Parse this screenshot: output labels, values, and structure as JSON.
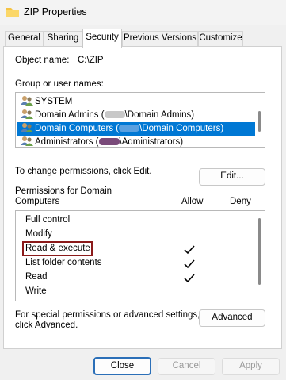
{
  "window": {
    "title": "ZIP Properties",
    "icon": "folder-icon"
  },
  "tabs": [
    {
      "label": "General",
      "active": false
    },
    {
      "label": "Sharing",
      "active": false
    },
    {
      "label": "Security",
      "active": true
    },
    {
      "label": "Previous Versions",
      "active": false
    },
    {
      "label": "Customize",
      "active": false
    }
  ],
  "object": {
    "label": "Object name:",
    "value": "C:\\ZIP"
  },
  "groups": {
    "label": "Group or user names:",
    "items": [
      {
        "prefix": "SYSTEM",
        "suffix": "",
        "redacted": false,
        "selected": false
      },
      {
        "prefix": "Domain Admins (",
        "suffix": "\\Domain Admins)",
        "redacted": true,
        "selected": false
      },
      {
        "prefix": "Domain Computers (",
        "suffix": "\\Domain Computers)",
        "redacted": true,
        "selected": true
      },
      {
        "prefix": "Administrators (",
        "suffix": "\\Administrators)",
        "redacted": true,
        "selected": false
      }
    ]
  },
  "change_text": "To change permissions, click Edit.",
  "edit_button": "Edit...",
  "permissions": {
    "header_line1": "Permissions for Domain",
    "header_line2": "Computers",
    "allow_label": "Allow",
    "deny_label": "Deny",
    "rows": [
      {
        "name": "Full control",
        "allow": false,
        "deny": false
      },
      {
        "name": "Modify",
        "allow": false,
        "deny": false
      },
      {
        "name": "Read & execute",
        "allow": true,
        "deny": false,
        "highlighted": true
      },
      {
        "name": "List folder contents",
        "allow": true,
        "deny": false
      },
      {
        "name": "Read",
        "allow": true,
        "deny": false
      },
      {
        "name": "Write",
        "allow": false,
        "deny": false
      }
    ]
  },
  "advanced_text_line1": "For special permissions or advanced settings,",
  "advanced_text_line2": "click Advanced.",
  "advanced_button": "Advanced",
  "footer": {
    "close": "Close",
    "cancel": "Cancel",
    "apply": "Apply"
  },
  "colors": {
    "selection": "#0078d4",
    "highlight_box": "#8b1a1a",
    "primary_border": "#2b6fb8"
  }
}
